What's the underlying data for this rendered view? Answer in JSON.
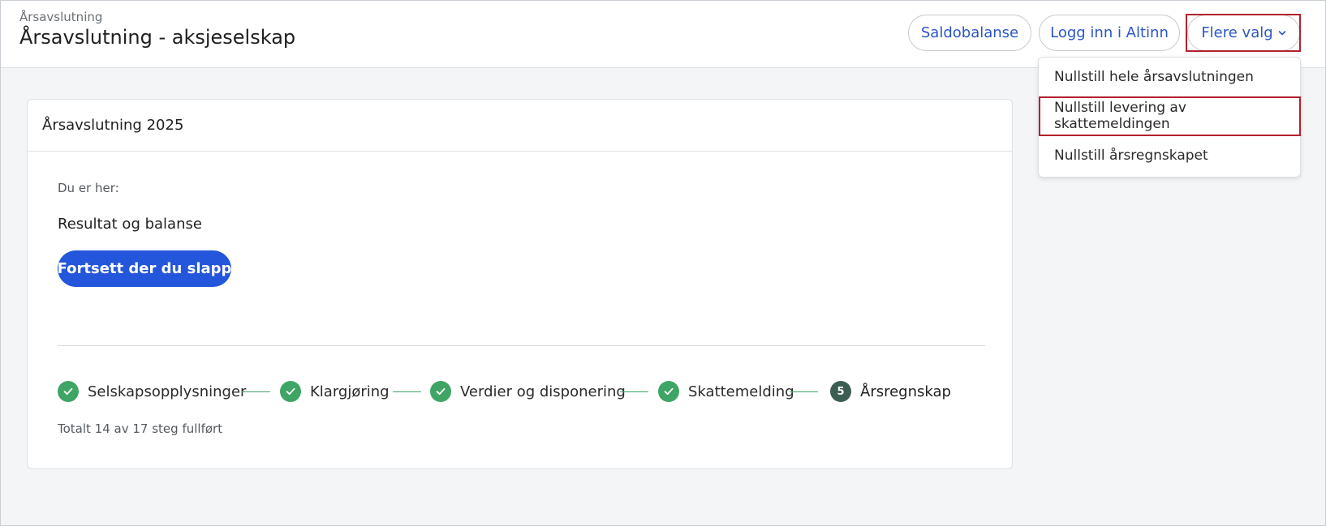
{
  "header": {
    "breadcrumb": "Årsavslutning",
    "title": "Årsavslutning - aksjeselskap",
    "buttons": {
      "saldobalanse": "Saldobalanse",
      "altinn": "Logg inn i Altinn",
      "flere_valg": "Flere valg"
    }
  },
  "dropdown": {
    "items": [
      {
        "label": "Nullstill hele årsavslutningen"
      },
      {
        "label": "Nullstill levering av skattemeldingen"
      },
      {
        "label": "Nullstill årsregnskapet"
      }
    ]
  },
  "card": {
    "title": "Årsavslutning 2025",
    "you_are_here": "Du er her:",
    "current_step": "Resultat og balanse",
    "continue_button": "Fortsett der du slapp",
    "steps": [
      {
        "label": "Selskapsopplysninger",
        "status": "done"
      },
      {
        "label": "Klargjøring",
        "status": "done"
      },
      {
        "label": "Verdier og disponering",
        "status": "done"
      },
      {
        "label": "Skattemelding",
        "status": "done"
      },
      {
        "label": "Årsregnskap",
        "status": "current",
        "number": "5"
      }
    ],
    "progress_text": "Totalt 14 av 17 steg fullført"
  },
  "colors": {
    "primary": "#2456dc",
    "link": "#2a56c6",
    "success": "#3fa566",
    "current_step": "#3c5e52",
    "highlight": "#b3222c"
  }
}
